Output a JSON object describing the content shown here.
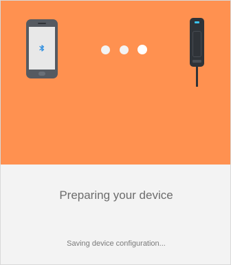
{
  "colors": {
    "hero_background": "#FF9150",
    "dot_inactive": "#F3F3F3",
    "dot_active": "#FFFFFF",
    "bluetooth": "#2F8FE0"
  },
  "illustration": {
    "left_icon": "smartphone-bluetooth-icon",
    "right_icon": "hub-device-icon",
    "progress_dots": 3,
    "active_dot": 3
  },
  "title": "Preparing your device",
  "status": "Saving device configuration..."
}
